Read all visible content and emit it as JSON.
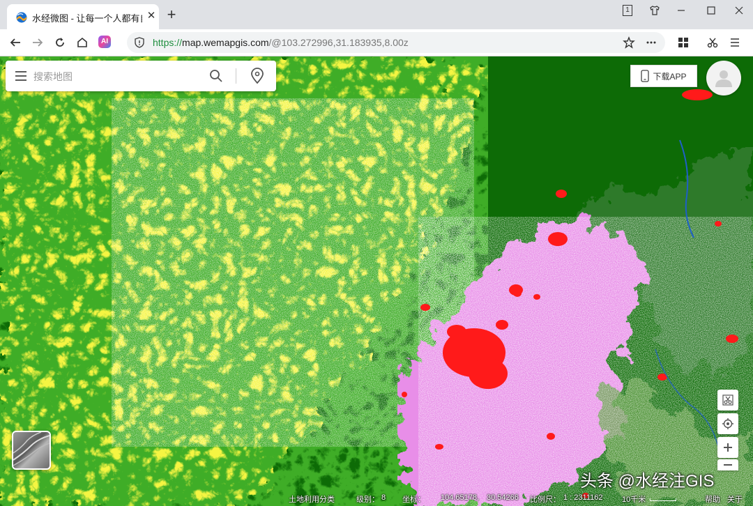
{
  "browser": {
    "tab_title": "水经微图 - 让每一个人都有自",
    "url_scheme": "https://",
    "url_host": "map.wemapgis.com",
    "url_path": "/@103.272996,31.183935,8.00z",
    "window_badge": "1"
  },
  "map": {
    "search_placeholder": "搜索地图",
    "download_app_label": "下载APP",
    "layer_name": "土地利用分类",
    "level_label": "级别：",
    "level_value": "8",
    "coord_label": "坐标：",
    "coord_lon": "104.65178,",
    "coord_lat": "30.54266",
    "scale_label": "比例尺：",
    "scale_value": "1 : 2311162",
    "scale_bar_label": "10千米",
    "help_label": "帮助",
    "about_label": "关于",
    "watermark": "头条 @水经注GIS"
  },
  "colors": {
    "forest": "#0d6b06",
    "cropland": "#f5f542",
    "urban": "#ff1a1a",
    "grassland": "#e88ee8",
    "water": "#1e5fc8"
  }
}
